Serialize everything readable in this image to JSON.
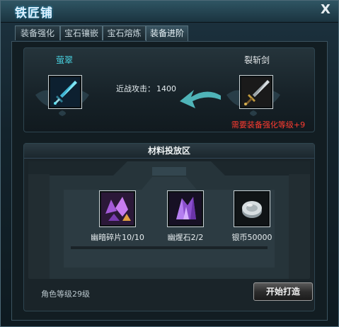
{
  "window": {
    "title": "铁匠铺",
    "close_glyph": "X"
  },
  "tabs": [
    {
      "label": "装备强化",
      "active": false
    },
    {
      "label": "宝石镶嵌",
      "active": false
    },
    {
      "label": "宝石熔炼",
      "active": false
    },
    {
      "label": "装备进阶",
      "active": true
    }
  ],
  "upgrade": {
    "target_name": "萤翠",
    "source_name": "裂斩剑",
    "stat_label": "近战攻击：",
    "stat_value": "1400",
    "requirement": "需要装备强化等级+9",
    "target_icon": "jade-sword-icon",
    "source_icon": "broad-sword-icon",
    "arrow_icon": "curved-arrow-left-icon"
  },
  "materials": {
    "title": "材料投放区",
    "items": [
      {
        "icon": "dark-shard-icon",
        "label": "幽暗碎片10/10"
      },
      {
        "icon": "dark-crystal-icon",
        "label": "幽煋石2/2"
      },
      {
        "icon": "silver-coin-icon",
        "label": "银币50000"
      }
    ]
  },
  "footer": {
    "level_text": "角色等级29级",
    "start_button": "开始打造"
  },
  "colors": {
    "accent_cyan": "#4ad7e6",
    "requirement_red": "#ff3b30"
  }
}
